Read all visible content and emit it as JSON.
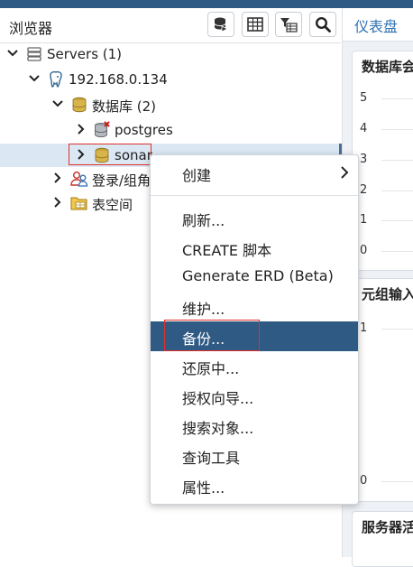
{
  "colors": {
    "header_bar": "#2f5a83",
    "selection_bg": "#dbe8f4",
    "menu_active": "#2f5a83",
    "highlight_box": "#e0302a",
    "tab_text": "#3273b2",
    "db_icon": "#c8a33a"
  },
  "browser": {
    "title": "浏览器",
    "toolbar": [
      {
        "name": "query-tool-icon"
      },
      {
        "name": "table-view-icon"
      },
      {
        "name": "filter-rows-icon"
      },
      {
        "name": "search-icon"
      }
    ]
  },
  "tree": {
    "servers": "Servers (1)",
    "server": "192.168.0.134",
    "databases": "数据库 (2)",
    "db_postgres": "postgres",
    "db_sonar": "sonar",
    "login_roles": "登录/组角",
    "tablespaces": "表空间"
  },
  "dashboard": {
    "tab": "仪表盘",
    "card1": {
      "title": "数据库会",
      "ticks": [
        "5",
        "4",
        "3",
        "2",
        "1",
        "0"
      ]
    },
    "card2": {
      "title": "元组输入",
      "ticks": [
        "1",
        "0"
      ]
    },
    "card3": {
      "title": "服务器活"
    }
  },
  "context_menu": {
    "items": [
      {
        "label": "创建",
        "submenu": true
      },
      {
        "label": "刷新..."
      },
      {
        "label": "CREATE 脚本"
      },
      {
        "label": "Generate ERD (Beta)"
      },
      {
        "label": "维护..."
      },
      {
        "label": "备份...",
        "active": true
      },
      {
        "label": "还原中..."
      },
      {
        "label": "授权向导..."
      },
      {
        "label": "搜索对象..."
      },
      {
        "label": "查询工具"
      },
      {
        "label": "属性..."
      }
    ]
  }
}
